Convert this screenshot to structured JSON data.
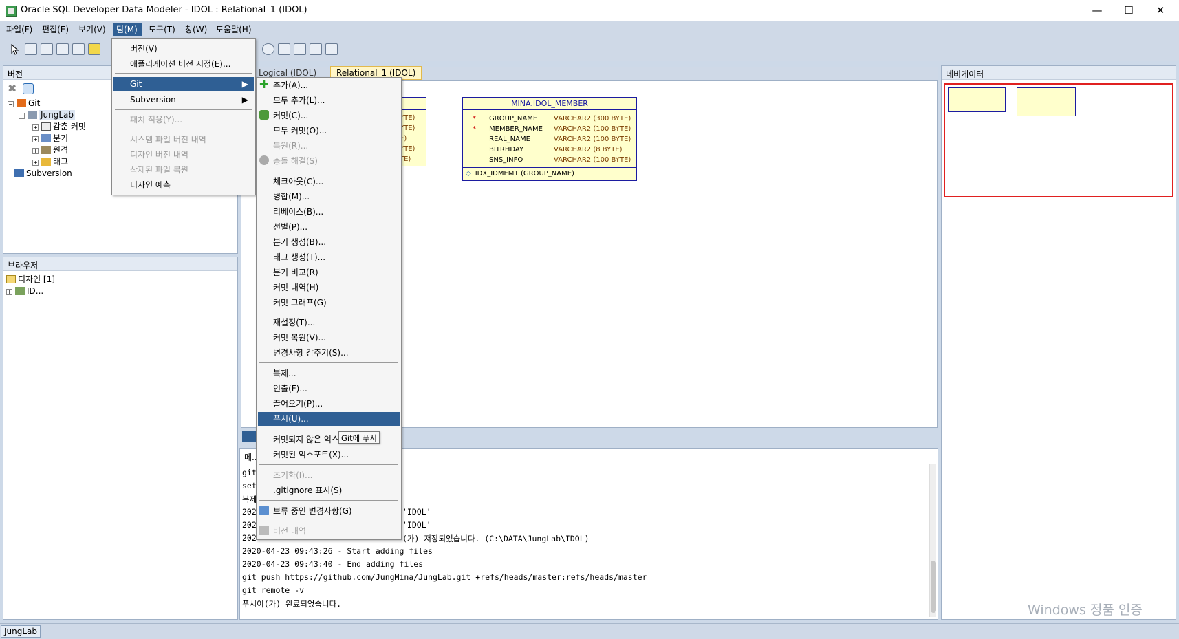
{
  "window": {
    "title": "Oracle SQL Developer Data Modeler - IDOL : Relational_1 (IDOL)",
    "minimize": "—",
    "maximize": "☐",
    "close": "✕"
  },
  "menubar": [
    "파일(F)",
    "편집(E)",
    "보기(V)",
    "팀(M)",
    "도구(T)",
    "창(W)",
    "도움말(H)"
  ],
  "versions_panel": {
    "title": "버전",
    "tree": [
      "Git",
      "JungLab",
      "감춘 커밋",
      "분기",
      "원격",
      "태그",
      "Subversion"
    ]
  },
  "browser_panel": {
    "title": "브라우저",
    "items": [
      "디자인 [1]",
      "ID..."
    ]
  },
  "navigator_panel": {
    "title": "네비게이터"
  },
  "editor_tabs": [
    "Logical (IDOL)",
    "Relational_1 (IDOL)"
  ],
  "team_menu": {
    "items": [
      "버전(V)",
      "애플리케이션 버전 지정(E)...",
      "Git",
      "Subversion",
      "패치 적용(Y)...",
      "시스템 파일 버전 내역",
      "디자인 버전 내역",
      "삭제된 파일 복원",
      "디자인 예측"
    ]
  },
  "git_menu": {
    "items": [
      "추가(A)...",
      "모두 추가(L)...",
      "커밋(C)...",
      "모두 커밋(O)...",
      "복원(R)...",
      "충돌 해결(S)",
      "체크아웃(C)...",
      "병합(M)...",
      "리베이스(B)...",
      "선별(P)...",
      "분기 생성(B)...",
      "태그 생성(T)...",
      "분기 비교(R)",
      "커밋 내역(H)",
      "커밋 그래프(G)",
      "재설정(T)...",
      "커밋 복원(V)...",
      "변경사항 감추기(S)...",
      "복제...",
      "인출(F)...",
      "끌어오기(P)...",
      "푸시(U)...",
      "커밋되지 않은 익스포트...",
      "커밋된 익스포트(X)...",
      "초기화(I)...",
      ".gitignore 표시(S)",
      "보류 중인 변경사항(G)",
      "버전 내역"
    ],
    "tooltip": "Git에 푸시"
  },
  "diagram": {
    "left_table": {
      "partial_types": [
        "YTE)",
        "YTE)",
        "E)",
        "YTE)",
        "TE)"
      ]
    },
    "member_table": {
      "name": "MINA.IDOL_MEMBER",
      "columns": [
        {
          "pk": "*",
          "name": "GROUP_NAME",
          "type": "VARCHAR2 (300 BYTE)"
        },
        {
          "pk": "*",
          "name": "MEMBER_NAME",
          "type": "VARCHAR2 (100 BYTE)"
        },
        {
          "pk": "",
          "name": "REAL_NAME",
          "type": "VARCHAR2 (100 BYTE)"
        },
        {
          "pk": "",
          "name": "BITRHDAY",
          "type": "VARCHAR2 (8 BYTE)"
        },
        {
          "pk": "",
          "name": "SNS_INFO",
          "type": "VARCHAR2 (100 BYTE)"
        }
      ],
      "index": "IDX_IDMEM1 (GROUP_NAME)"
    }
  },
  "messages_panel": {
    "title": "메...",
    "left_fragments": [
      "git",
      "set",
      "복제",
      "202",
      "202",
      "202"
    ],
    "lines": [
      "'IDOL'",
      "'IDOL'",
      "(가) 저장되었습니다. (C:\\DATA\\JungLab\\IDOL)",
      "2020-04-23 09:43:26 - Start adding files",
      "2020-04-23 09:43:40 - End adding files",
      "git push https://github.com/JungMina/JungLab.git +refs/heads/master:refs/heads/master",
      "git remote -v",
      "푸시이(가) 완료되었습니다."
    ]
  },
  "statusbar": {
    "text": "JungLab"
  },
  "watermark": "Windows 정품 인증",
  "colors": {
    "accent": "#2f5f94",
    "table_border": "#1c1ca0",
    "table_fill": "#ffffcc"
  }
}
